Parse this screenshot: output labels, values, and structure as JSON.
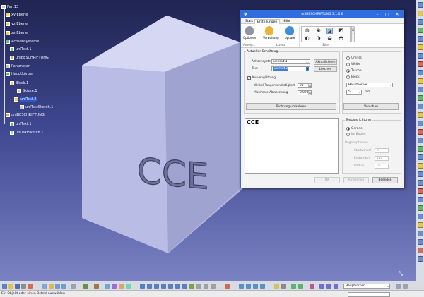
{
  "tree": {
    "items": [
      {
        "label": "Part13"
      },
      {
        "label": "xy-Ebene"
      },
      {
        "label": "yz-Ebene"
      },
      {
        "label": "zx-Ebene"
      },
      {
        "label": "Achsensysteme"
      },
      {
        "label": "uniText.1"
      },
      {
        "label": "uniBESCHRIFTUNG"
      },
      {
        "label": "Parameter"
      },
      {
        "label": "Hauptkörper"
      },
      {
        "label": "Block.1"
      },
      {
        "label": "Skizze.1"
      },
      {
        "label": "uniText.2"
      },
      {
        "label": "uniTextSketch.1"
      },
      {
        "label": "uniBESCHRIFTUNG"
      },
      {
        "label": "uniText.1"
      },
      {
        "label": "uniTextSketch.1"
      }
    ]
  },
  "cube": {
    "text": "CCE"
  },
  "dialog": {
    "title": "uniBESCHRIFTUNG 3.1.0.6",
    "tabs": {
      "start": "Start",
      "create": "Erstellungen",
      "help": "Hilfe"
    },
    "ribbon": {
      "options": "Optionen",
      "manage": "Verwaltung",
      "update": "Update",
      "group_a": "Anzeig...",
      "group_b": "Lizenz",
      "group_c": "Stile"
    },
    "section_title": "Aktueller Schriftzug",
    "axis_label": "Achsensystem",
    "axis_value": "uniText.1",
    "text_label": "Text",
    "text_value": "uniText.2",
    "btn_axis": "Aktualisieren",
    "btn_delete": "Löschen",
    "curve_label": "Kurvenglättung",
    "curve_checked": "✓",
    "tangent_label": "Winkel Tangentenstetigkeit",
    "tangent_value": "90",
    "deviation_label": "Maximale Abweichung",
    "deviation_value": "0,090",
    "btn_direction": "Richtung umkehren",
    "text_content": "CCE",
    "mode": {
      "opt1": "Umriss",
      "opt2": "Wölbe",
      "opt3": "Tasche",
      "opt4": "Block"
    },
    "body_value": "Hauptkörper",
    "depth_value": "5",
    "depth_unit": "mm",
    "btn_preview": "Vorschau",
    "text_align_title": "Textausrichtung",
    "align": {
      "a1": "Gerade",
      "a2": "Im Bogen"
    },
    "arc_title": "Bogenoptionen",
    "arc": {
      "start_label": "Startwinkel",
      "start_value": "0",
      "end_label": "Endwinkel",
      "end_value": "180",
      "radius_label": "Radius",
      "radius_value": "50"
    },
    "btn_ok": "OK",
    "btn_apply": "Anwenden",
    "btn_close": "Beenden"
  },
  "status": {
    "message": "Ein Objekt oder einen Befehl auswählen",
    "input_value": ""
  },
  "toolbar": {
    "body_select": "Hauptkörper"
  }
}
